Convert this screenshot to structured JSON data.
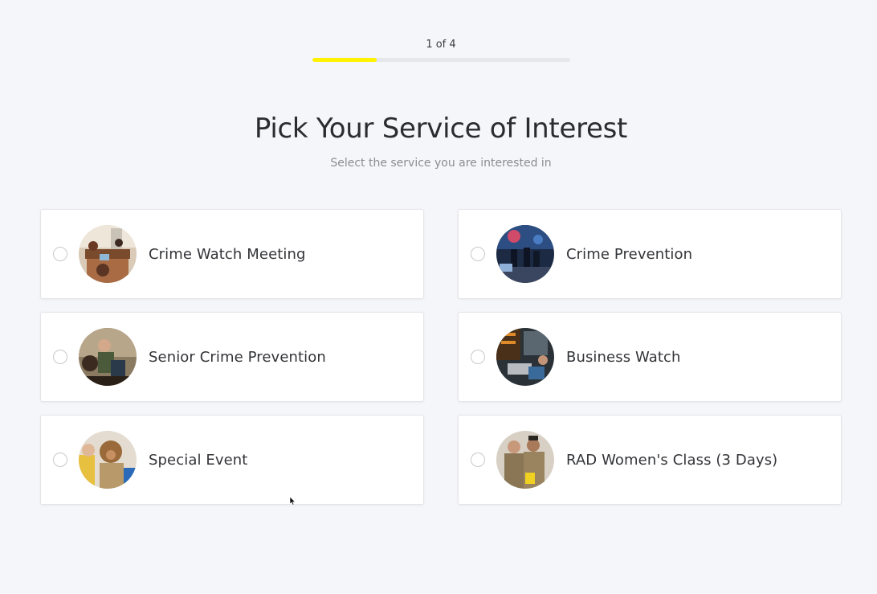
{
  "progress": {
    "step_text": "1 of 4",
    "fraction": 0.25,
    "fill_color": "#fff200"
  },
  "header": {
    "title": "Pick Your Service of Interest",
    "subtitle": "Select the service you are interested in"
  },
  "options": [
    {
      "label": "Crime Watch Meeting",
      "icon": "meeting-photo"
    },
    {
      "label": "Crime Prevention",
      "icon": "police-night-photo"
    },
    {
      "label": "Senior Crime Prevention",
      "icon": "senior-photo"
    },
    {
      "label": "Business Watch",
      "icon": "business-photo"
    },
    {
      "label": "Special Event",
      "icon": "mascot-photo"
    },
    {
      "label": "RAD Women's Class (3 Days)",
      "icon": "officers-photo"
    }
  ]
}
